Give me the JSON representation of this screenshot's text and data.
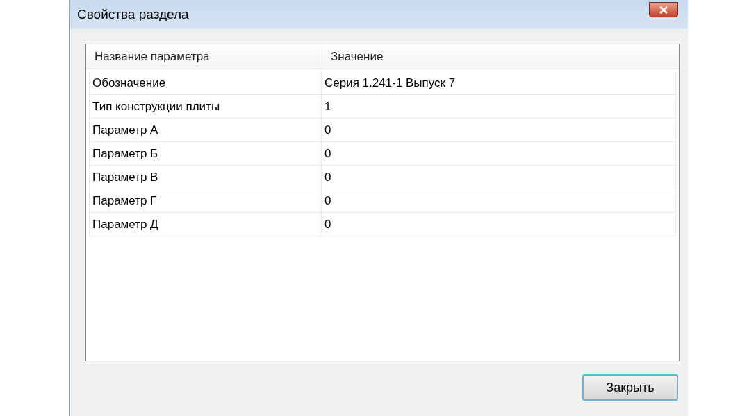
{
  "window": {
    "title": "Свойства раздела"
  },
  "table": {
    "columns": [
      "Название параметра",
      "Значение"
    ],
    "rows": [
      {
        "name": "Обозначение",
        "value": "Серия 1.241-1 Выпуск 7"
      },
      {
        "name": "Тип конструкции плиты",
        "value": "1"
      },
      {
        "name": "Параметр А",
        "value": "0"
      },
      {
        "name": "Параметр Б",
        "value": "0"
      },
      {
        "name": "Параметр В",
        "value": "0"
      },
      {
        "name": "Параметр Г",
        "value": "0"
      },
      {
        "name": "Параметр Д",
        "value": "0"
      }
    ]
  },
  "buttons": [
    "Закрыть"
  ]
}
